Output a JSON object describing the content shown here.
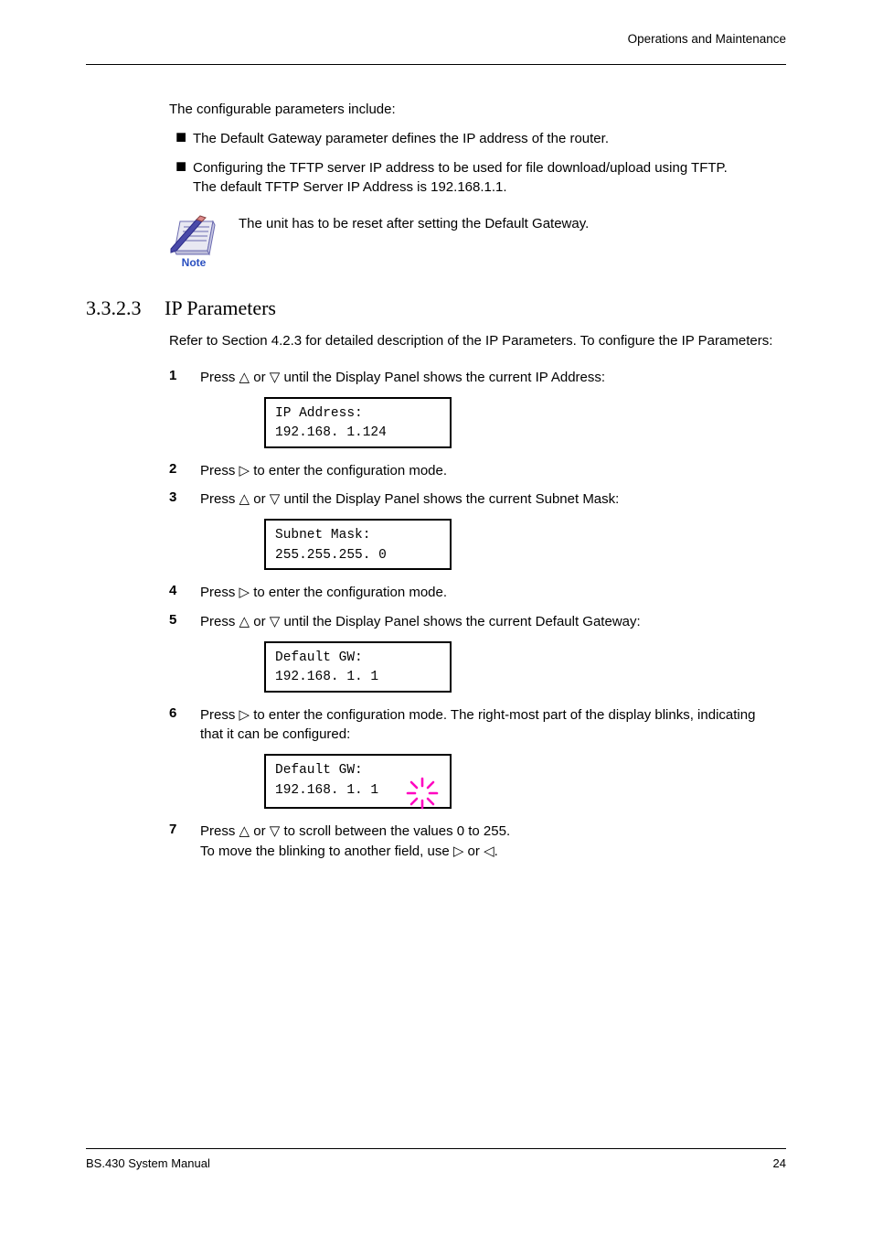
{
  "header": {
    "right_line": "Operations and Maintenance"
  },
  "intro": {
    "text": "The configurable parameters include:",
    "bullets": [
      "The Default Gateway parameter defines the IP address of the router.",
      "Configuring the TFTP server IP address to be used for file download/upload using TFTP. The default TFTP Server IP Address is 192.168.1.1."
    ]
  },
  "note": {
    "icon_label": "Note",
    "text": "The unit has to be reset after setting the Default Gateway."
  },
  "section": {
    "number": "3.3.2.3",
    "title": "IP Parameters",
    "intro": "Refer to Section 4.2.3 for detailed description of the IP Parameters. To configure the IP Parameters:"
  },
  "steps": [
    {
      "num": "1",
      "text_before": "Press ",
      "tri1": "△",
      "mid": " or ",
      "tri2": "▽",
      "text_after": " until the Display Panel shows the current IP Address:",
      "display": {
        "line1": "IP Address:",
        "line2": "192.168. 1.124"
      }
    },
    {
      "num": "2",
      "text": "Press ▷ to enter the configuration mode."
    },
    {
      "num": "3",
      "text_before": "Press ",
      "tri1": "△",
      "mid": " or ",
      "tri2": "▽",
      "text_after": " until the Display Panel shows the current Subnet Mask:",
      "display": {
        "line1": "Subnet Mask:",
        "line2": " 255.255.255. 0"
      }
    },
    {
      "num": "4",
      "text": "Press ▷ to enter the configuration mode."
    },
    {
      "num": "5",
      "text_before": "Press ",
      "tri1": "△",
      "mid": " or ",
      "tri2": "▽",
      "text_after": " until the Display Panel shows the current Default Gateway:",
      "display": {
        "line1": "Default GW:",
        "line2": " 192.168. 1. 1"
      }
    },
    {
      "num": "6",
      "text_before": "Press ",
      "tri": "▷",
      "text_after": " to enter the configuration mode. The right-most part of the display blinks, indicating that it can be configured:",
      "display": {
        "line1": "Default GW:",
        "line2": " 192.168. 1. 1",
        "blink": true
      }
    },
    {
      "num": "7",
      "line1_before": "Press ",
      "l1_tri1": "△",
      "l1_mid": " or ",
      "l1_tri2": "▽",
      "line1_after": " to scroll between the values 0 to 255.",
      "line2_before": "To move the blinking to another field, use ",
      "l2_tri1": "▷",
      "l2_mid": " or ",
      "l2_tri2": "◁",
      "line2_after": "."
    }
  ],
  "footer": {
    "left": "BS.430 System Manual",
    "right": "24"
  }
}
